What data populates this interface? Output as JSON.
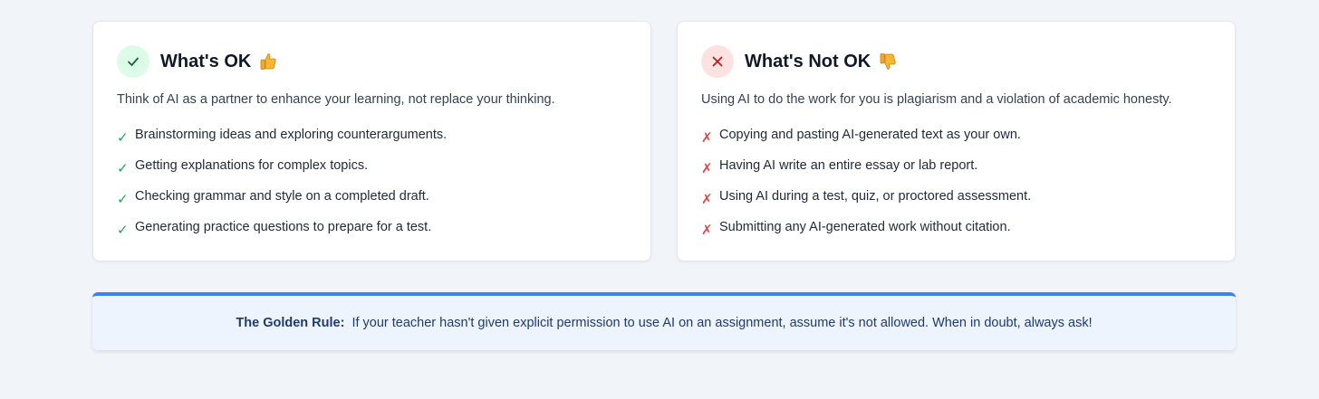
{
  "ok_card": {
    "title": "What's OK",
    "emoji_icon": "thumbs-up-icon",
    "description": "Think of AI as a partner to enhance your learning, not replace your thinking.",
    "mark": "✓",
    "items": [
      "Brainstorming ideas and exploring counterarguments.",
      "Getting explanations for complex topics.",
      "Checking grammar and style on a completed draft.",
      "Generating practice questions to prepare for a test."
    ]
  },
  "not_card": {
    "title": "What's Not OK",
    "emoji_icon": "thumbs-down-icon",
    "description": "Using AI to do the work for you is plagiarism and a violation of academic honesty.",
    "mark": "✗",
    "items": [
      "Copying and pasting AI-generated text as your own.",
      "Having AI write an entire essay or lab report.",
      "Using AI during a test, quiz, or proctored assessment.",
      "Submitting any AI-generated work without citation."
    ]
  },
  "golden_rule": {
    "label": "The Golden Rule:",
    "text": "If your teacher hasn't given explicit permission to use AI on an assignment, assume it's not allowed. When in doubt, always ask!"
  },
  "colors": {
    "ok_green": "#22a559",
    "not_red": "#e04848",
    "accent_blue": "#3b82f6"
  }
}
